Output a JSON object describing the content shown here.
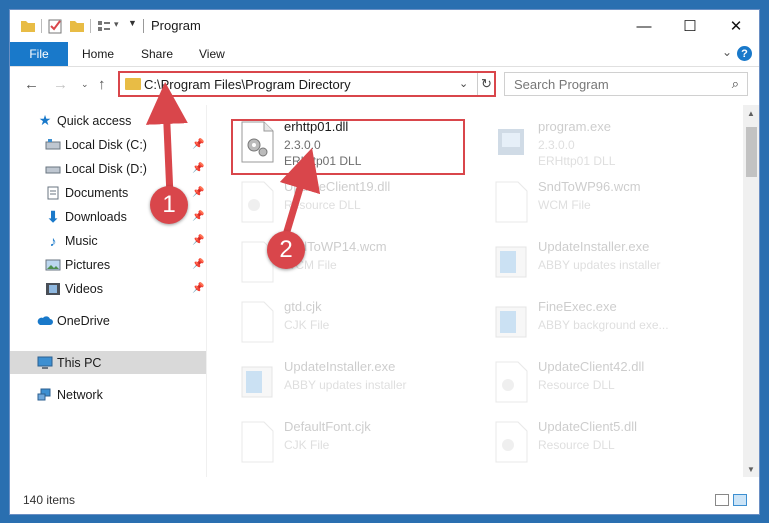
{
  "window": {
    "title": "Program"
  },
  "ribbon": {
    "tabs": [
      "File",
      "Home",
      "Share",
      "View"
    ],
    "help": "?"
  },
  "address": {
    "path": "C:\\Program Files\\Program Directory"
  },
  "search": {
    "placeholder": "Search Program"
  },
  "sidebar": {
    "items": [
      {
        "label": "Quick access",
        "icon": "star-icon",
        "pinned": false
      },
      {
        "label": "Local Disk (C:)",
        "icon": "drive-icon",
        "pinned": true
      },
      {
        "label": "Local Disk (D:)",
        "icon": "drive-icon",
        "pinned": true
      },
      {
        "label": "Documents",
        "icon": "documents-icon",
        "pinned": true
      },
      {
        "label": "Downloads",
        "icon": "downloads-icon",
        "pinned": true
      },
      {
        "label": "Music",
        "icon": "music-icon",
        "pinned": true
      },
      {
        "label": "Pictures",
        "icon": "pictures-icon",
        "pinned": true
      },
      {
        "label": "Videos",
        "icon": "videos-icon",
        "pinned": true
      },
      {
        "label": "OneDrive",
        "icon": "cloud-icon",
        "pinned": false
      },
      {
        "label": "This PC",
        "icon": "computer-icon",
        "pinned": false,
        "selected": true
      },
      {
        "label": "Network",
        "icon": "network-icon",
        "pinned": false
      }
    ]
  },
  "files": [
    {
      "name": "erhttp01.dll",
      "line1": "2.3.0.0",
      "line2": "ERHttp01 DLL",
      "icon": "dll-icon",
      "highlighted": true
    },
    {
      "name": "program.exe",
      "line1": "2.3.0.0",
      "line2": "ERHttp01 DLL",
      "icon": "exe-icon"
    },
    {
      "name": "UpdateClient19.dll",
      "line1": "Resource DLL",
      "line2": "",
      "icon": "dll-icon"
    },
    {
      "name": "SndToWP96.wcm",
      "line1": "WCM File",
      "line2": "",
      "icon": "file-icon"
    },
    {
      "name": "SndToWP14.wcm",
      "line1": "WCM File",
      "line2": "",
      "icon": "file-icon"
    },
    {
      "name": "UpdateInstaller.exe",
      "line1": "ABBY updates installer",
      "line2": "",
      "icon": "installer-icon"
    },
    {
      "name": "gtd.cjk",
      "line1": "CJK File",
      "line2": "",
      "icon": "file-icon"
    },
    {
      "name": "FineExec.exe",
      "line1": "ABBY background exe...",
      "line2": "",
      "icon": "installer-icon"
    },
    {
      "name": "UpdateInstaller.exe",
      "line1": "ABBY updates installer",
      "line2": "",
      "icon": "installer-icon"
    },
    {
      "name": "UpdateClient42.dll",
      "line1": "Resource DLL",
      "line2": "",
      "icon": "dll-icon"
    },
    {
      "name": "DefaultFont.cjk",
      "line1": "CJK File",
      "line2": "",
      "icon": "file-icon"
    },
    {
      "name": "UpdateClient5.dll",
      "line1": "Resource DLL",
      "line2": "",
      "icon": "dll-icon"
    }
  ],
  "status": {
    "item_count": "140 items"
  },
  "callouts": {
    "one": "1",
    "two": "2"
  },
  "colors": {
    "accent": "#1979ca",
    "highlight": "#d9464b"
  }
}
